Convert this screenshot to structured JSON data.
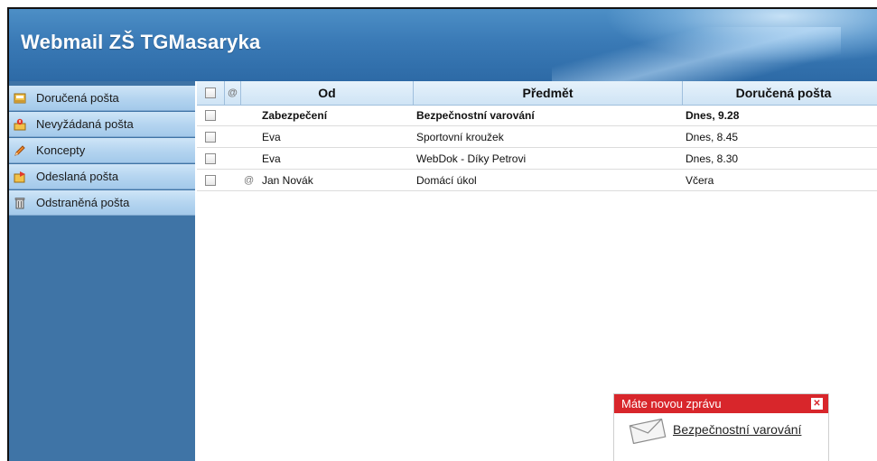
{
  "app": {
    "title": "Webmail ZŠ TGMasaryka"
  },
  "sidebar": {
    "items": [
      {
        "label": "Doručená pošta",
        "icon": "inbox-icon"
      },
      {
        "label": "Nevyžádaná pošta",
        "icon": "spam-icon"
      },
      {
        "label": "Koncepty",
        "icon": "pencil-icon"
      },
      {
        "label": "Odeslaná pošta",
        "icon": "sent-icon"
      },
      {
        "label": "Odstraněná pošta",
        "icon": "trash-icon"
      }
    ]
  },
  "table": {
    "columns": {
      "from": "Od",
      "subject": "Předmět",
      "received": "Doručená pošta"
    },
    "rows": [
      {
        "from": "Zabezpečení",
        "subject": "Bezpečnostní varování",
        "received": "Dnes, 9.28",
        "unread": true,
        "attachment": false
      },
      {
        "from": "Eva",
        "subject": "Sportovní kroužek",
        "received": "Dnes, 8.45",
        "unread": false,
        "attachment": false
      },
      {
        "from": "Eva",
        "subject": "WebDok - Díky Petrovi",
        "received": "Dnes, 8.30",
        "unread": false,
        "attachment": false
      },
      {
        "from": "Jan Novák",
        "subject": "Domácí úkol",
        "received": "Včera",
        "unread": false,
        "attachment": true
      }
    ]
  },
  "notification": {
    "title": "Máte novou zprávu",
    "close_icon": "close-icon",
    "link": "Bezpečnostní varování",
    "icon": "envelope-icon"
  },
  "colors": {
    "header_blue": "#3a7ab6",
    "sidebar_blue": "#3f74a6",
    "folder_light": "#b5d5f0",
    "notification_red": "#d8262b"
  }
}
